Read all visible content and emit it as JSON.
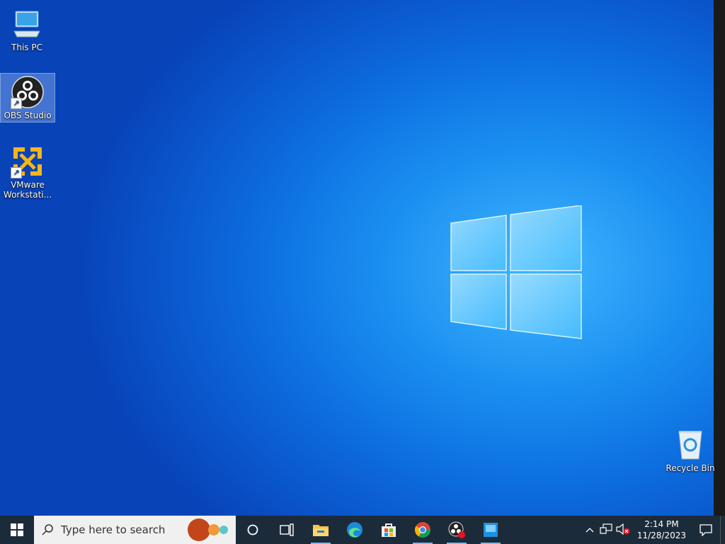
{
  "desktop": {
    "icons": [
      {
        "label": "This PC",
        "icon": "computer-icon"
      },
      {
        "label": "OBS Studio",
        "icon": "obs-icon"
      },
      {
        "label": "VMware Workstati...",
        "icon": "vmware-icon"
      },
      {
        "label": "Recycle Bin",
        "icon": "recycle-bin-icon"
      }
    ]
  },
  "taskbar": {
    "search_placeholder": "Type here to search",
    "apps": [
      "cortana-icon",
      "task-view-icon",
      "file-explorer-icon",
      "edge-icon",
      "microsoft-store-icon",
      "chrome-icon",
      "obs-icon",
      "app-icon"
    ],
    "clock": {
      "time": "2:14 PM",
      "date": "11/28/2023"
    }
  },
  "colors": {
    "taskbar": "#1c2b3a",
    "accent": "#0a6fe0"
  }
}
